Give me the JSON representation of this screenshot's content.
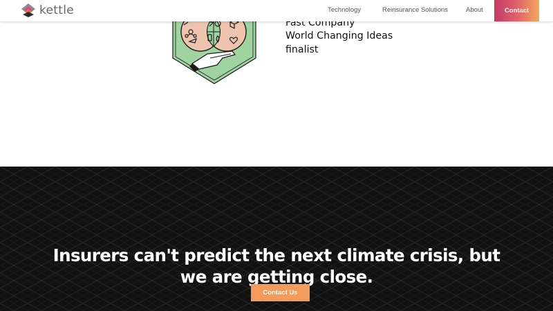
{
  "brand": {
    "name": "kettle",
    "logo_icon": "layered-diamond-logo-icon"
  },
  "nav": {
    "items": [
      {
        "label": "Technology"
      },
      {
        "label": "Reinsurance Solutions"
      },
      {
        "label": "About"
      }
    ],
    "contact_label": "Contact"
  },
  "award": {
    "badge_icon": "world-changing-ideas-badge-icon",
    "lines": [
      "Fast Company",
      "World Changing Ideas",
      "finalist"
    ]
  },
  "cta": {
    "headline_lines": [
      "Insurers can't predict the next climate crisis, but",
      "we are getting close."
    ],
    "button_label": "Contact Us"
  },
  "colors": {
    "nav_contact_gradient": [
      "#c43a64",
      "#e0616a",
      "#f3a85d"
    ],
    "cta_background": "#121212",
    "cta_button": "#f49a5a",
    "badge_green": "#9fd3a0",
    "badge_peach": "#efc4ae"
  }
}
